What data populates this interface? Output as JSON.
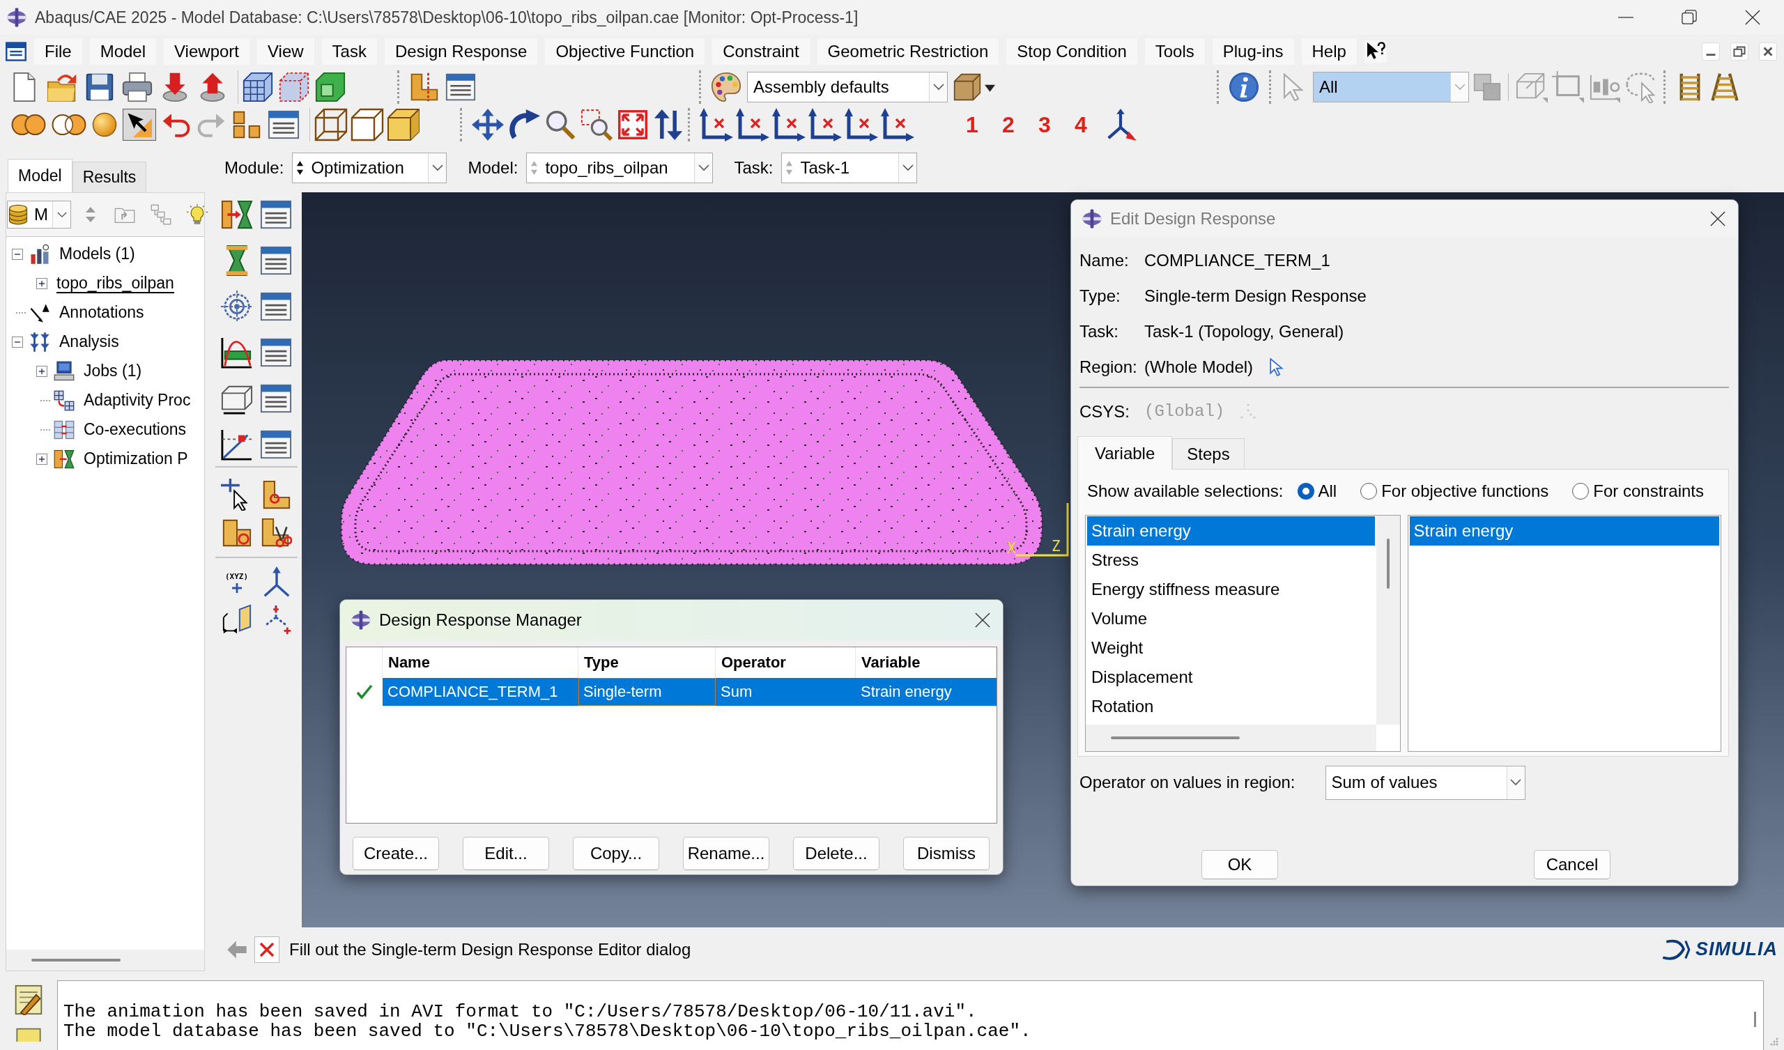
{
  "window": {
    "title": "Abaqus/CAE 2025 - Model Database: C:\\Users\\78578\\Desktop\\06-10\\topo_ribs_oilpan.cae [Monitor: Opt-Process-1]"
  },
  "menu_bar": {
    "items": [
      "File",
      "Model",
      "Viewport",
      "View",
      "Task",
      "Design Response",
      "Objective Function",
      "Constraint",
      "Geometric Restriction",
      "Stop Condition",
      "Tools",
      "Plug-ins",
      "Help"
    ]
  },
  "toolbar": {
    "render_style": "Assembly defaults",
    "selection_filter": {
      "value": "All",
      "highlighted": true
    },
    "pick_pressed": true,
    "redo_enabled": false,
    "selection_tools_enabled": false,
    "user_views": [
      "1",
      "2",
      "3",
      "4"
    ]
  },
  "context_bar": {
    "fields": [
      {
        "label": "Module:",
        "value": "Optimization",
        "spinner_enabled": true
      },
      {
        "label": "Model:",
        "value": "topo_ribs_oilpan",
        "spinner_enabled": false
      },
      {
        "label": "Task:",
        "value": "Task-1",
        "spinner_enabled": false
      }
    ]
  },
  "model_tree": {
    "tabs": [
      {
        "label": "Model",
        "selected": true
      },
      {
        "label": "Results",
        "selected": false
      }
    ],
    "filter": "M",
    "items": [
      {
        "label": "Models (1)",
        "kind": "models",
        "expanded": true,
        "current": false,
        "children": [
          {
            "label": "topo_ribs_oilpan",
            "kind": "model",
            "expanded": false,
            "current": true
          }
        ]
      },
      {
        "label": "Annotations",
        "kind": "annotations",
        "current": false
      },
      {
        "label": "Analysis",
        "kind": "analysis",
        "expanded": true,
        "current": false,
        "children": [
          {
            "label": "Jobs (1)",
            "kind": "jobs",
            "expanded": false,
            "current": false
          },
          {
            "label": "Adaptivity Proc",
            "kind": "adaptivity",
            "current": false
          },
          {
            "label": "Co-executions",
            "kind": "coexecutions",
            "current": false
          },
          {
            "label": "Optimization P",
            "kind": "optimization",
            "expanded": false,
            "current": false
          }
        ]
      }
    ]
  },
  "toolbox": {
    "datum_point_label": "(XYZ)"
  },
  "viewport": {
    "triad_labels": [
      "X",
      "Z"
    ]
  },
  "edit_design_response": {
    "title": "Edit Design Response",
    "active": false,
    "fields": [
      {
        "label": "Name:",
        "value": "COMPLIANCE_TERM_1",
        "pickable": false
      },
      {
        "label": "Type:",
        "value": "Single-term Design Response",
        "pickable": false
      },
      {
        "label": "Task:",
        "value": "Task-1 (Topology, General)",
        "pickable": false
      },
      {
        "label": "Region:",
        "value": "(Whole Model)",
        "pickable": true
      }
    ],
    "csys": {
      "label": "CSYS:",
      "value": "(Global)",
      "enabled": false
    },
    "tabs": [
      {
        "label": "Variable",
        "selected": true
      },
      {
        "label": "Steps",
        "selected": false
      }
    ],
    "show_selections": {
      "label": "Show available selections:",
      "options": [
        {
          "label": "All",
          "selected": true
        },
        {
          "label": "For objective functions",
          "selected": false
        },
        {
          "label": "For constraints",
          "selected": false
        }
      ]
    },
    "variables": [
      {
        "label": "Strain energy",
        "selected": true
      },
      {
        "label": "Stress",
        "selected": false
      },
      {
        "label": "Energy stiffness measure",
        "selected": false
      },
      {
        "label": "Volume",
        "selected": false
      },
      {
        "label": "Weight",
        "selected": false
      },
      {
        "label": "Displacement",
        "selected": false
      },
      {
        "label": "Rotation",
        "selected": false
      }
    ],
    "chosen_variables": [
      {
        "label": "Strain energy",
        "selected": true
      }
    ],
    "operator": {
      "label": "Operator on values in region:",
      "value": "Sum of values"
    },
    "buttons": [
      "OK",
      "Cancel"
    ]
  },
  "design_response_manager": {
    "title": "Design Response Manager",
    "active": true,
    "columns": [
      {
        "kind": "status"
      },
      {
        "kind": "text",
        "label": "Name"
      },
      {
        "kind": "text",
        "label": "Type"
      },
      {
        "kind": "text",
        "label": "Operator"
      },
      {
        "kind": "text",
        "label": "Variable"
      }
    ],
    "rows": [
      {
        "selected": true,
        "cells": [
          {
            "kind": "status",
            "valid": true
          },
          {
            "kind": "text",
            "text": "COMPLIANCE_TERM_1",
            "focused": false
          },
          {
            "kind": "text",
            "text": "Single-term",
            "focused": true
          },
          {
            "kind": "text",
            "text": "Sum",
            "focused": false
          },
          {
            "kind": "text",
            "text": "Strain energy",
            "focused": false
          }
        ]
      }
    ],
    "buttons": [
      "Create...",
      "Edit...",
      "Copy...",
      "Rename...",
      "Delete...",
      "Dismiss"
    ]
  },
  "prompt": {
    "text": "Fill out the Single-term Design Response Editor dialog"
  },
  "brand": {
    "logo_text": "SIMULIA"
  },
  "message_area": {
    "lines": [
      "The animation has been saved in AVI format to \"C:/Users/78578/Desktop/06-10/11.avi\".",
      "The model database has been saved to \"C:\\Users\\78578\\Desktop\\06-10\\topo_ribs_oilpan.cae\"."
    ]
  }
}
